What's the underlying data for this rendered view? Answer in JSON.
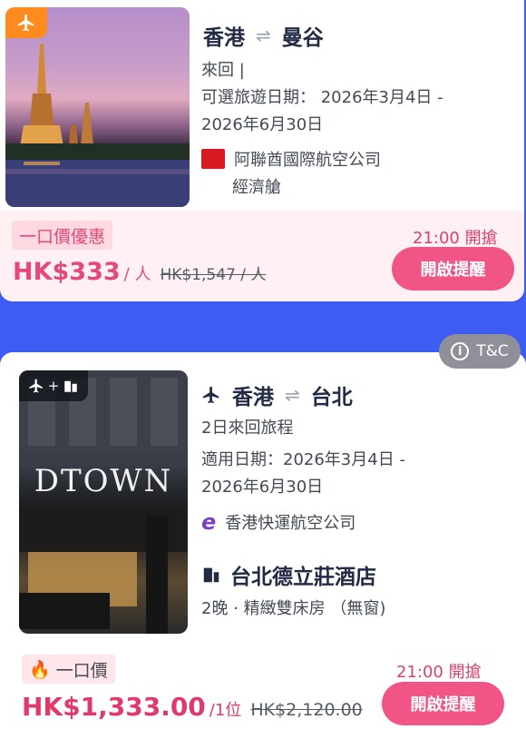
{
  "card1": {
    "origin": "香港",
    "destination": "曼谷",
    "trip_type": "來回 |",
    "date_line1": "可選旅遊日期： 2026年3月4日 -",
    "date_line2": "2026年6月30日",
    "airline": "阿聯酋國際航空公司",
    "cabin": "經濟艙",
    "tag": "一口價優惠",
    "price": "HK$333",
    "per": "/ 人",
    "old_price": "HK$1,547 / 人",
    "time": "21:00 開搶",
    "button": "開啟提醒"
  },
  "card2": {
    "tc": "T&C",
    "origin": "香港",
    "destination": "台北",
    "trip_type": "2日來回旅程",
    "date_line1": "適用日期：2026年3月4日 -",
    "date_line2": "2026年6月30日",
    "airline": "香港快運航空公司",
    "hotel": "台北德立莊酒店",
    "room": "2晚 · 精緻雙床房 （無窗)",
    "tag": "一口價",
    "price": "HK$1,333.00",
    "per": "/1位",
    "old_price": "HK$2,120.00",
    "time": "21:00 開搶",
    "button": "開啟提醒",
    "badge_text": "+",
    "sign_text": "DTOWN"
  },
  "colors": {
    "background": "#3d5cf2",
    "accent": "#e5487a",
    "button": "#f05586",
    "flight_badge": "#ff8a1e"
  },
  "icons": [
    "plane-icon",
    "swap-arrows-icon",
    "building-icon",
    "fire-icon",
    "info-icon",
    "emirates-logo",
    "hk-express-logo"
  ]
}
